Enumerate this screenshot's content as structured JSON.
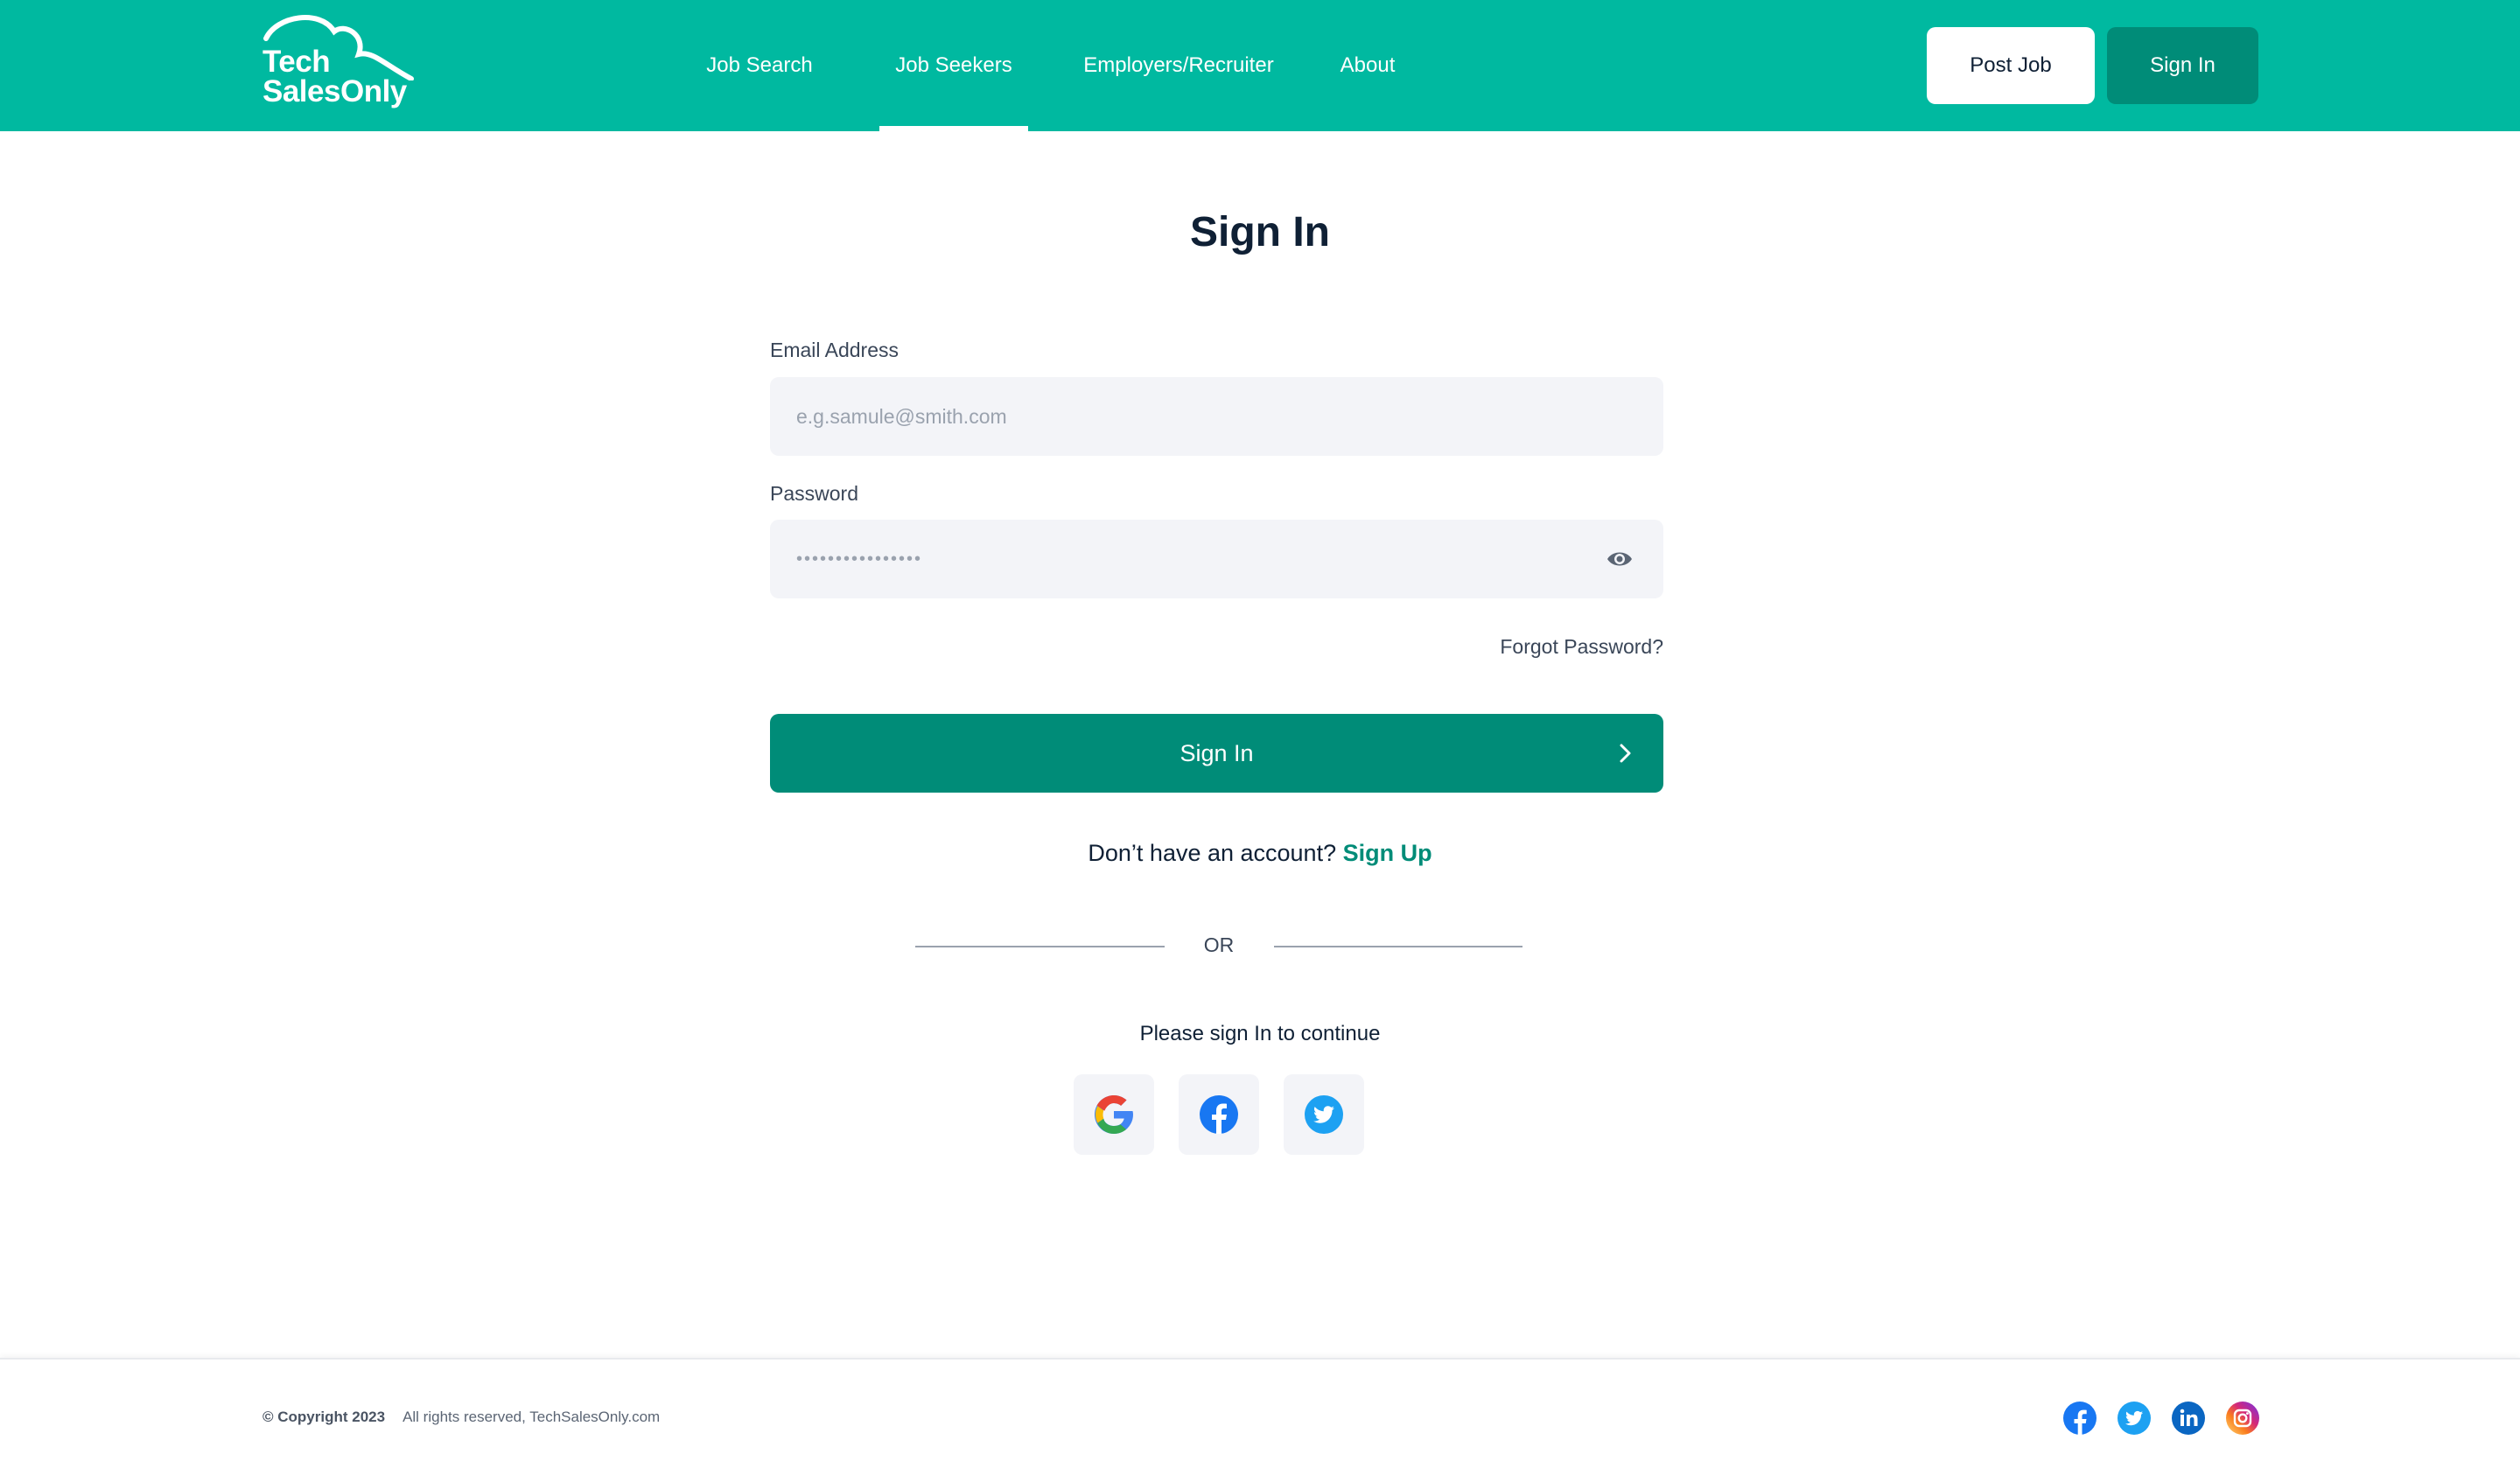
{
  "header": {
    "logo": {
      "line1": "Tech",
      "line2": "SalesOnly"
    },
    "nav": [
      {
        "label": "Job Search"
      },
      {
        "label": "Job Seekers",
        "active": true
      },
      {
        "label": "Employers/Recruiter"
      },
      {
        "label": "About"
      }
    ],
    "post_job_label": "Post Job",
    "sign_in_label": "Sign In"
  },
  "main": {
    "title": "Sign In",
    "email": {
      "label": "Email Address",
      "placeholder": "e.g.samule@smith.com"
    },
    "password": {
      "label": "Password",
      "placeholder": "••••••••••••••••",
      "toggle_icon": "eye-icon"
    },
    "forgot_label": "Forgot Password?",
    "submit_label": "Sign In",
    "signup_prompt": "Don’t have an account?",
    "signup_link": "Sign Up",
    "or_label": "OR",
    "continue_text": "Please sign In to continue",
    "social_buttons": [
      "google-icon",
      "facebook-icon",
      "twitter-icon"
    ]
  },
  "footer": {
    "copyright": "© Copyright 2023",
    "rights": "All rights reserved, TechSalesOnly.com",
    "social_icons": [
      "facebook-icon",
      "twitter-icon",
      "linkedin-icon",
      "instagram-icon"
    ]
  },
  "colors": {
    "header_bg": "#00b9a0",
    "primary_dark": "#008c78",
    "input_bg": "#f3f4f8",
    "text_dark": "#0f2035"
  }
}
